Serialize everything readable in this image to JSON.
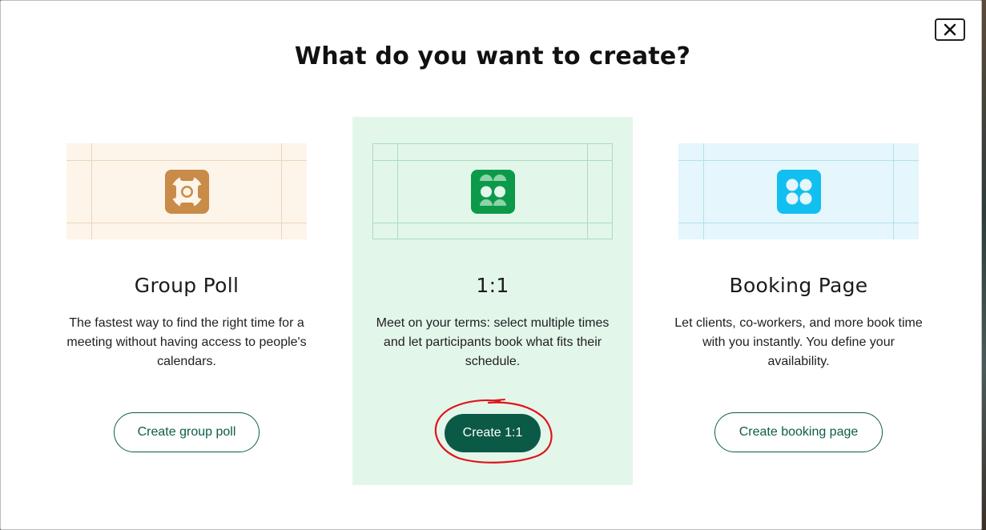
{
  "modal": {
    "title": "What do you want to create?",
    "close_icon": "close-icon"
  },
  "cards": [
    {
      "key": "group-poll",
      "title": "Group Poll",
      "description": "The fastest way to find the right time for a meeting without having access to people's calendars.",
      "button_label": "Create group poll",
      "icon": "group-poll-icon",
      "accent": "#c98b48",
      "background": "#fdf4ea"
    },
    {
      "key": "one-on-one",
      "title": "1:1",
      "description": "Meet on your terms: select multiple times and let participants book what fits their schedule.",
      "button_label": "Create 1:1",
      "icon": "one-on-one-icon",
      "accent": "#0c9a4a",
      "background": "#e3f6ea",
      "highlighted": true
    },
    {
      "key": "booking-page",
      "title": "Booking Page",
      "description": "Let clients, co-workers, and more book time with you instantly. You define your availability.",
      "button_label": "Create booking page",
      "icon": "booking-page-icon",
      "accent": "#12bff0",
      "background": "#e5f6fd"
    }
  ],
  "colors": {
    "primary": "#0b5a47",
    "annotation": "#e0141a"
  }
}
